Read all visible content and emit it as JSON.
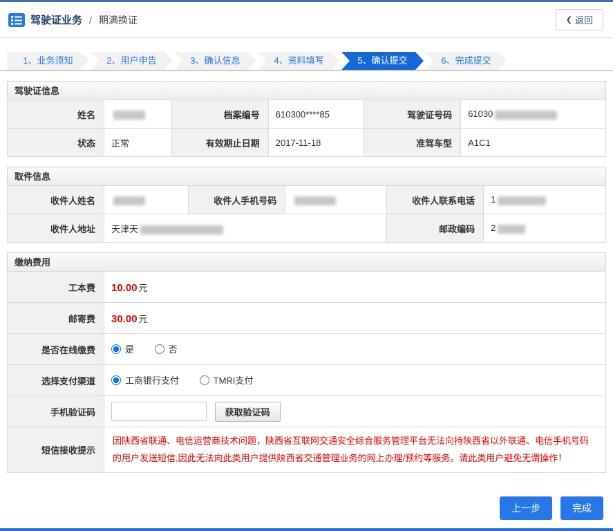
{
  "header": {
    "title": "驾驶证业务",
    "divider": "/",
    "subtitle": "期满换证",
    "back": "返回"
  },
  "steps": {
    "s1": "1、业务须知",
    "s2": "2、用户申告",
    "s3": "3、确认信息",
    "s4": "4、资料填写",
    "s5": "5、确认提交",
    "s6": "6、完成提交"
  },
  "license": {
    "title": "驾驶证信息",
    "name_label": "姓名",
    "file_label": "档案编号",
    "file_value": "610300****85",
    "license_no_label": "驾驶证号码",
    "license_no_prefix": "61030",
    "status_label": "状态",
    "status_value": "正常",
    "expiry_label": "有效期止日期",
    "expiry_value": "2017-11-18",
    "vehicle_label": "准驾车型",
    "vehicle_value": "A1C1"
  },
  "pickup": {
    "title": "取件信息",
    "name_label": "收件人姓名",
    "mobile_label": "收件人手机号码",
    "phone_label": "收件人联系电话",
    "phone_prefix": "1",
    "address_label": "收件人地址",
    "address_prefix": "天津天",
    "postal_label": "邮政编码",
    "postal_prefix": "2"
  },
  "fees": {
    "title": "缴纳费用",
    "production_label": "工本费",
    "production_value": "10.00",
    "mailing_label": "邮寄费",
    "mailing_value": "30.00",
    "unit": "元",
    "online_label": "是否在线缴费",
    "online_yes": "是",
    "online_no": "否",
    "channel_label": "选择支付渠道",
    "channel_icbc": "工商银行支付",
    "channel_tmri": "TMRI支付",
    "sms_label": "手机验证码",
    "sms_button": "获取验证码",
    "notice_label": "短信接收提示",
    "notice_text": "因陕西省联通、电信运营商技术问题，陕西省互联网交通安全综合服务管理平台无法向持陕西省以外联通、电信手机号码的用户发送短信,因此无法向此类用户提供陕西省交通管理业务的网上办理/预约等服务。请此类用户避免无谓操作！"
  },
  "footer": {
    "prev": "上一步",
    "finish": "完成"
  }
}
